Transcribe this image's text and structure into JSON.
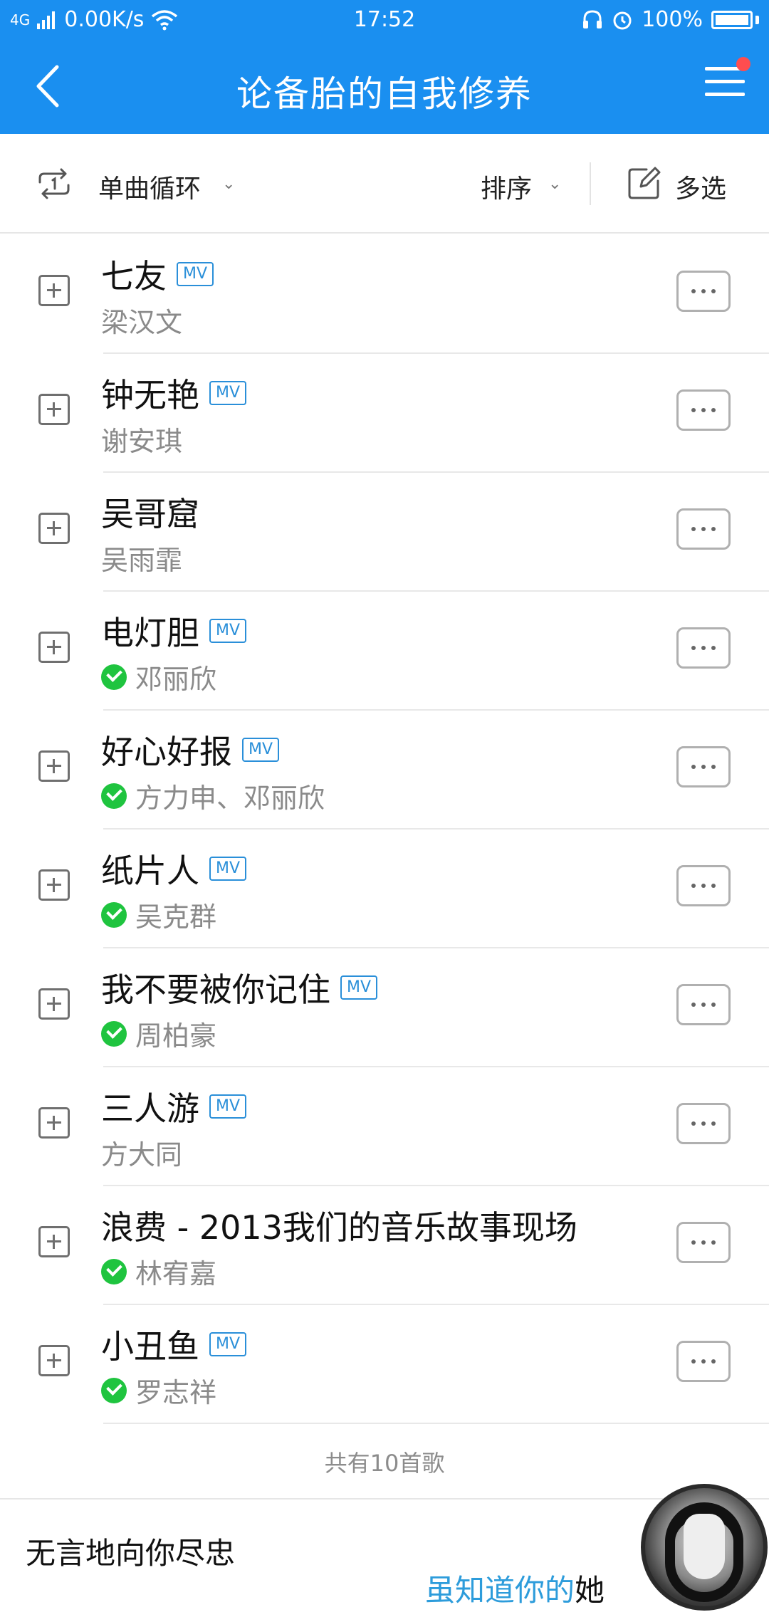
{
  "status_bar": {
    "network": "4G",
    "speed": "0.00K/s",
    "time": "17:52",
    "battery": "100%"
  },
  "header": {
    "title": "论备胎的自我修养",
    "background_color": "#1a8ff0",
    "has_notification_dot": true
  },
  "toolbar": {
    "loop_mode": "单曲循环",
    "sort_label": "排序",
    "multi_select_label": "多选"
  },
  "songs": [
    {
      "title": "七友",
      "artist": "梁汉文",
      "mv": "MV",
      "downloaded": false
    },
    {
      "title": "钟无艳",
      "artist": "谢安琪",
      "mv": "MV",
      "downloaded": false
    },
    {
      "title": "吴哥窟",
      "artist": "吴雨霏",
      "mv": "",
      "downloaded": false
    },
    {
      "title": "电灯胆",
      "artist": "邓丽欣",
      "mv": "MV",
      "downloaded": true
    },
    {
      "title": "好心好报",
      "artist": "方力申、邓丽欣",
      "mv": "MV",
      "downloaded": true
    },
    {
      "title": "纸片人",
      "artist": "吴克群",
      "mv": "MV",
      "downloaded": true
    },
    {
      "title": "我不要被你记住",
      "artist": "周柏豪",
      "mv": "MV",
      "downloaded": true
    },
    {
      "title": "三人游",
      "artist": "方大同",
      "mv": "MV",
      "downloaded": false
    },
    {
      "title": "浪费 - 2013我们的音乐故事现场",
      "artist": "林宥嘉",
      "mv": "",
      "downloaded": true
    },
    {
      "title": "小丑鱼",
      "artist": "罗志祥",
      "mv": "MV",
      "downloaded": true
    }
  ],
  "song_count": "共有10首歌",
  "player": {
    "lyric_line_1": "无言地向你尽忠",
    "lyric_line_2_highlight": "虽知道你的",
    "lyric_line_2_rest": "她",
    "highlight_color": "#2d9cdb"
  }
}
